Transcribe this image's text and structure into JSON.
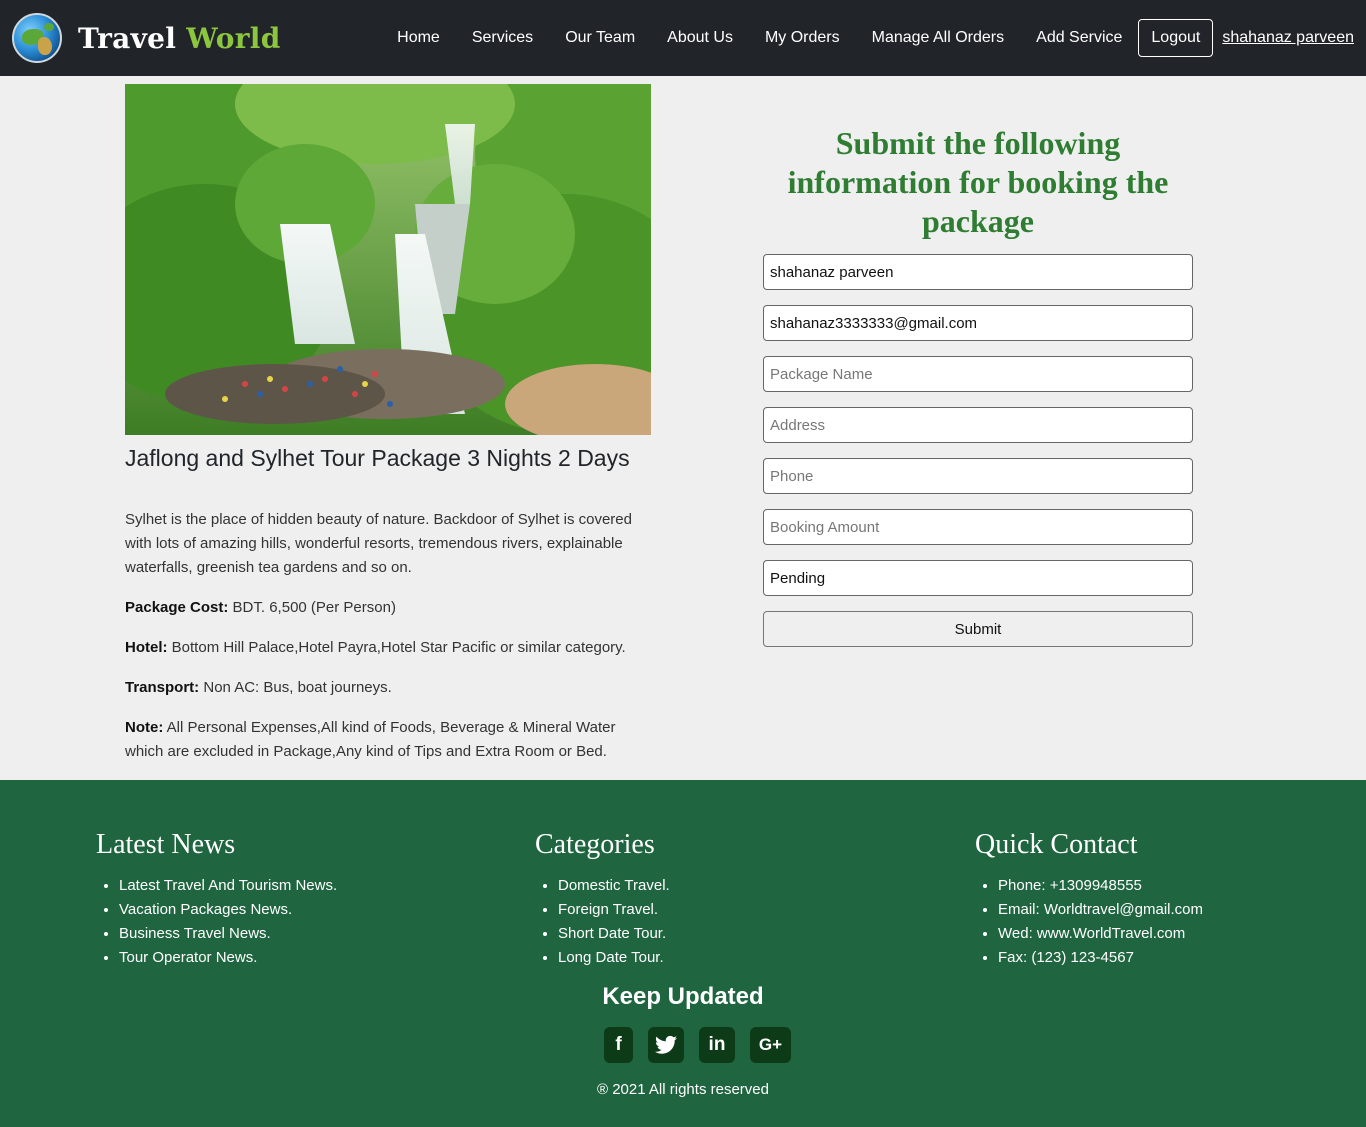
{
  "nav": {
    "brand_part1": "Travel",
    "brand_part2": "World",
    "links": [
      "Home",
      "Services",
      "Our Team",
      "About Us",
      "My Orders",
      "Manage All Orders",
      "Add Service"
    ],
    "logout": "Logout",
    "user": "shahanaz parveen"
  },
  "package": {
    "title": "Jaflong and Sylhet Tour Package 3 Nights 2 Days",
    "description": "Sylhet is the place of hidden beauty of nature. Backdoor of Sylhet is covered with lots of amazing hills, wonderful resorts, tremendous rivers, explainable waterfalls, greenish tea gardens and so on.",
    "cost_label": "Package Cost:",
    "cost_value": " BDT. 6,500 (Per Person)",
    "hotel_label": "Hotel:",
    "hotel_value": " Bottom Hill Palace,Hotel Payra,Hotel Star Pacific or similar category.",
    "transport_label": "Transport:",
    "transport_value": " Non AC: Bus, boat journeys.",
    "note_label": "Note:",
    "note_value": " All Personal Expenses,All kind of Foods, Beverage & Mineral Water which are excluded in Package,Any kind of Tips and Extra Room or Bed."
  },
  "form": {
    "title": "Submit the following information for booking the package",
    "name_value": "shahanaz parveen",
    "email_value": "shahanaz3333333@gmail.com",
    "package_placeholder": "Package Name",
    "address_placeholder": "Address",
    "phone_placeholder": "Phone",
    "amount_placeholder": "Booking Amount",
    "status_value": "Pending",
    "submit": "Submit"
  },
  "footer": {
    "news_title": "Latest News",
    "news": [
      "Latest Travel And Tourism News.",
      "Vacation Packages News.",
      "Business Travel News.",
      "Tour Operator News."
    ],
    "categories_title": "Categories",
    "categories": [
      "Domestic Travel.",
      "Foreign Travel.",
      "Short Date Tour.",
      "Long Date Tour."
    ],
    "contact_title": "Quick Contact",
    "contact": [
      "Phone: +1309948555",
      "Email: Worldtravel@gmail.com",
      "Wed: www.WorldTravel.com",
      "Fax: (123) 123-4567"
    ],
    "keep_updated": "Keep Updated",
    "socials": [
      "f",
      "in",
      "G+"
    ],
    "copyright": "® 2021 All rights reserved"
  },
  "colors": {
    "navbar": "#212529",
    "brand_accent": "#8cc63f",
    "form_title": "#2e7d32",
    "footer": "#1e6540",
    "social_bg": "#0d3b18"
  }
}
